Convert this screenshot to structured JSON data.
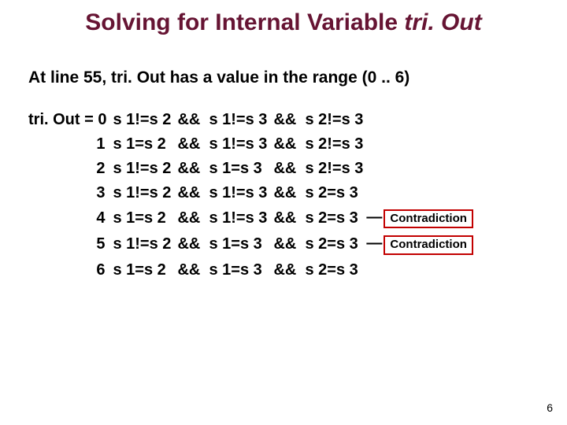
{
  "title_prefix": "Solving for Internal Variable ",
  "title_em": "tri. Out",
  "subtitle": "At line 55, tri. Out has a value in the range (0 .. 6)",
  "label_prefix": "tri. Out = ",
  "rows": [
    {
      "n": "0",
      "c1": "s 1!=s 2",
      "op1": "&&",
      "c2": "s 1!=s 3",
      "op2": "&&",
      "c3": "s 2!=s 3",
      "annot": ""
    },
    {
      "n": "1",
      "c1": "s 1=s 2",
      "op1": "&&",
      "c2": "s 1!=s 3",
      "op2": "&&",
      "c3": "s 2!=s 3",
      "annot": ""
    },
    {
      "n": "2",
      "c1": "s 1!=s 2",
      "op1": "&&",
      "c2": "s 1=s 3",
      "op2": "&&",
      "c3": "s 2!=s 3",
      "annot": ""
    },
    {
      "n": "3",
      "c1": "s 1!=s 2",
      "op1": "&&",
      "c2": "s 1!=s 3",
      "op2": "&&",
      "c3": "s 2=s 3",
      "annot": ""
    },
    {
      "n": "4",
      "c1": "s 1=s 2",
      "op1": "&&",
      "c2": "s 1!=s 3",
      "op2": "&&",
      "c3": "s 2=s 3",
      "annot": "Contradiction"
    },
    {
      "n": "5",
      "c1": "s 1!=s 2",
      "op1": "&&",
      "c2": "s 1=s 3",
      "op2": "&&",
      "c3": "s 2=s 3",
      "annot": "Contradiction"
    },
    {
      "n": "6",
      "c1": "s 1=s 2",
      "op1": "&&",
      "c2": "s 1=s 3",
      "op2": "&&",
      "c3": "s 2=s 3",
      "annot": ""
    }
  ],
  "page_number": "6"
}
